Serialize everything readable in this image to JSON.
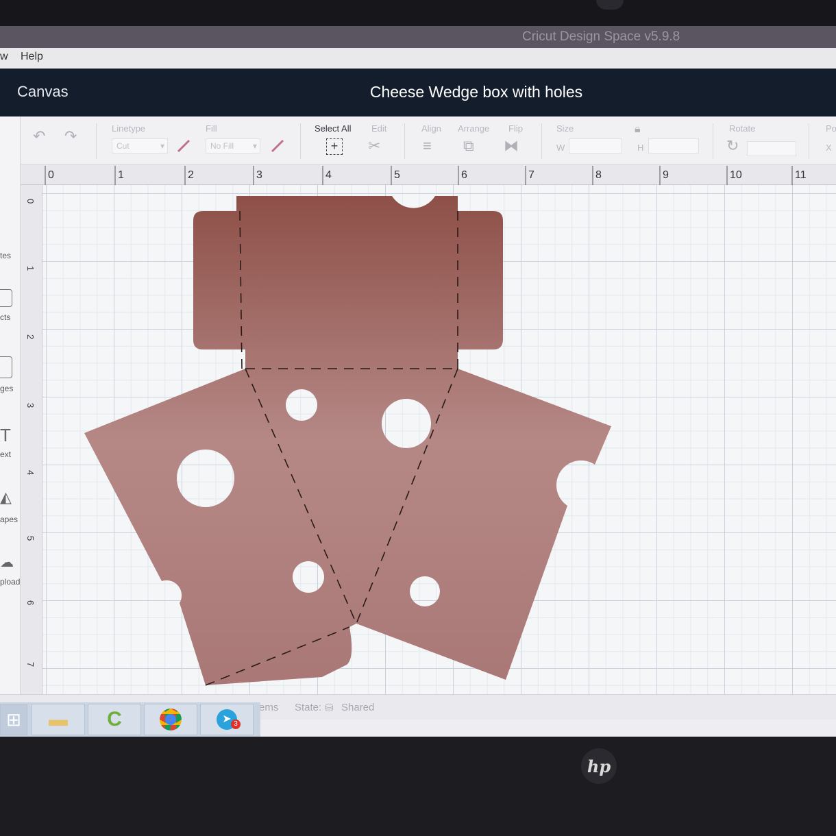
{
  "app": {
    "title": "Cricut Design Space  v5.9.8"
  },
  "menu": {
    "items": [
      "w",
      "Help"
    ]
  },
  "header": {
    "canvas_label": "Canvas",
    "project_title": "Cheese Wedge box with holes"
  },
  "toolbar": {
    "linetype_label": "Linetype",
    "linetype_value": "Cut",
    "fill_label": "Fill",
    "fill_value": "No Fill",
    "select_all_label": "Select All",
    "edit_label": "Edit",
    "align_label": "Align",
    "arrange_label": "Arrange",
    "flip_label": "Flip",
    "size_label": "Size",
    "w_label": "W",
    "h_label": "H",
    "rotate_label": "Rotate",
    "position_label": "Po",
    "x_label": "X"
  },
  "sidebar": {
    "items": [
      {
        "label": "tes",
        "icon": "templates-icon"
      },
      {
        "label": "cts",
        "icon": "projects-icon"
      },
      {
        "label": "ges",
        "icon": "images-icon"
      },
      {
        "label": "ext",
        "icon": "text-icon"
      },
      {
        "label": "apes",
        "icon": "shapes-icon"
      },
      {
        "label": "pload",
        "icon": "upload-icon"
      }
    ]
  },
  "ruler": {
    "top": [
      "0",
      "1",
      "2",
      "3",
      "4",
      "5",
      "6",
      "7",
      "8",
      "9",
      "10",
      "11"
    ],
    "left": [
      "0",
      "1",
      "2",
      "3",
      "4",
      "5",
      "6",
      "7"
    ]
  },
  "status": {
    "items_label": "0 items",
    "state_label": "State:",
    "state_value": "Shared"
  },
  "taskbar": {
    "badge_count": "3"
  },
  "design": {
    "fill_color": "#9a6560",
    "hole_color": "#f2f4f6",
    "score_color": "#2a1a18"
  },
  "monitor": {
    "brand": "hp"
  }
}
